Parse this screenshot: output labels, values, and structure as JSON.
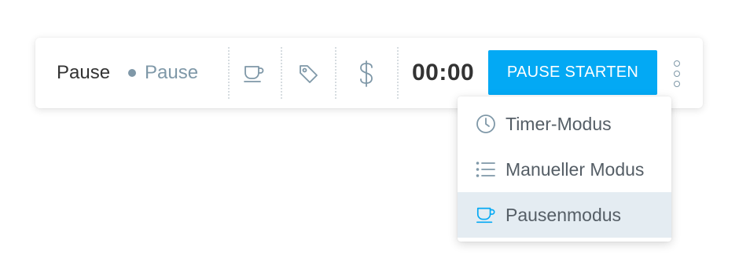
{
  "toolbar": {
    "description": "Pause",
    "project": "Pause",
    "project_color": "#7f98a8",
    "icons": [
      "coffee-cup-icon",
      "tag-icon",
      "dollar-icon"
    ],
    "timer": "00:00",
    "start_button_label": "PAUSE STARTEN",
    "accent_color": "#03a9f4",
    "more_icon": "vertical-dots-icon"
  },
  "mode_menu": {
    "items": [
      {
        "label": "Timer-Modus",
        "icon": "clock-icon",
        "selected": false
      },
      {
        "label": "Manueller Modus",
        "icon": "list-icon",
        "selected": false
      },
      {
        "label": "Pausenmodus",
        "icon": "coffee-cup-icon",
        "selected": true
      }
    ],
    "selected_background": "#e4ecf2"
  }
}
